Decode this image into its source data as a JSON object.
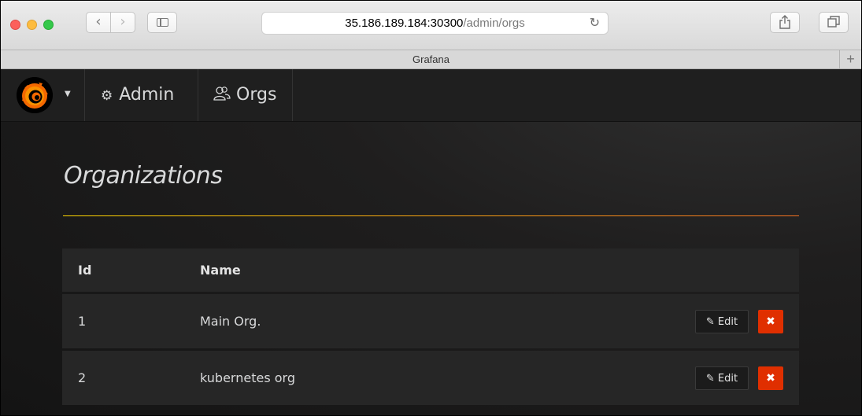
{
  "browser": {
    "url_host": "35.186.189.184:30300",
    "url_path": "/admin/orgs",
    "tab_title": "Grafana",
    "new_tab_label": "+"
  },
  "nav": {
    "breadcrumbs": [
      {
        "label": "Admin",
        "icon": "cogs-icon"
      },
      {
        "label": "Orgs",
        "icon": "users-icon"
      }
    ]
  },
  "page": {
    "title": "Organizations"
  },
  "table": {
    "columns": [
      "Id",
      "Name"
    ],
    "rows": [
      {
        "id": "1",
        "name": "Main Org.",
        "edit_label": "Edit"
      },
      {
        "id": "2",
        "name": "kubernetes org",
        "edit_label": "Edit"
      }
    ]
  },
  "colors": {
    "accent_gradient_start": "#ffd700",
    "accent_gradient_end": "#f37121",
    "delete_button": "#e02f00",
    "background": "#1f1e1e"
  }
}
